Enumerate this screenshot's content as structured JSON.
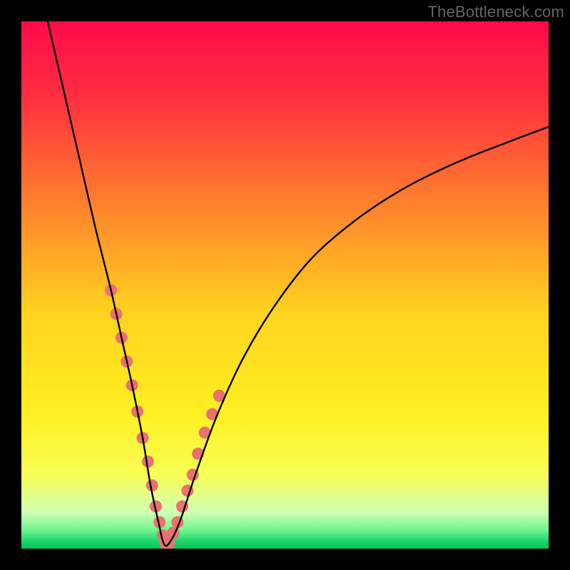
{
  "watermark": "TheBottleneck.com",
  "gradient": {
    "stops": [
      {
        "pos": 0.0,
        "color": "#ff0b48"
      },
      {
        "pos": 0.15,
        "color": "#ff3140"
      },
      {
        "pos": 0.33,
        "color": "#ff7a2e"
      },
      {
        "pos": 0.55,
        "color": "#ffd21f"
      },
      {
        "pos": 0.74,
        "color": "#ffef21"
      },
      {
        "pos": 0.86,
        "color": "#f8ff55"
      },
      {
        "pos": 0.93,
        "color": "#d2ffb4"
      },
      {
        "pos": 0.965,
        "color": "#70f58e"
      },
      {
        "pos": 0.985,
        "color": "#1dd66c"
      },
      {
        "pos": 1.0,
        "color": "#00c462"
      }
    ]
  },
  "chart_data": {
    "type": "line",
    "title": "",
    "xlabel": "",
    "ylabel": "",
    "xlim": [
      0,
      100
    ],
    "ylim": [
      0,
      100
    ],
    "series": [
      {
        "name": "bottleneck-curve",
        "x": [
          5,
          8,
          11,
          14,
          17,
          19,
          21,
          23,
          24.5,
          26,
          27,
          28,
          30,
          33,
          37,
          42,
          48,
          55,
          63,
          72,
          82,
          92,
          100
        ],
        "y": [
          100,
          87,
          74,
          61,
          49,
          40,
          31,
          21,
          12,
          5,
          1,
          1,
          5,
          14,
          25,
          36,
          46,
          55,
          62,
          68,
          73,
          77,
          80
        ]
      }
    ],
    "markers": {
      "comment": "salmon dotted overlay segments along the V near the bottom",
      "color": "#e97170",
      "left_segment": {
        "x": [
          17,
          18,
          19,
          20,
          21,
          22,
          23,
          24,
          24.8,
          25.5,
          26.2,
          26.8,
          27.3
        ],
        "y": [
          49,
          44.5,
          40,
          35.5,
          31,
          26,
          21,
          16.5,
          12,
          8,
          5,
          2.5,
          1
        ]
      },
      "right_segment": {
        "x": [
          28,
          28.8,
          29.6,
          30.5,
          31.5,
          32.5,
          33.5,
          34.8,
          36.2,
          37.5
        ],
        "y": [
          1,
          3,
          5,
          8,
          11,
          14,
          18,
          22,
          25.5,
          29
        ]
      }
    }
  }
}
